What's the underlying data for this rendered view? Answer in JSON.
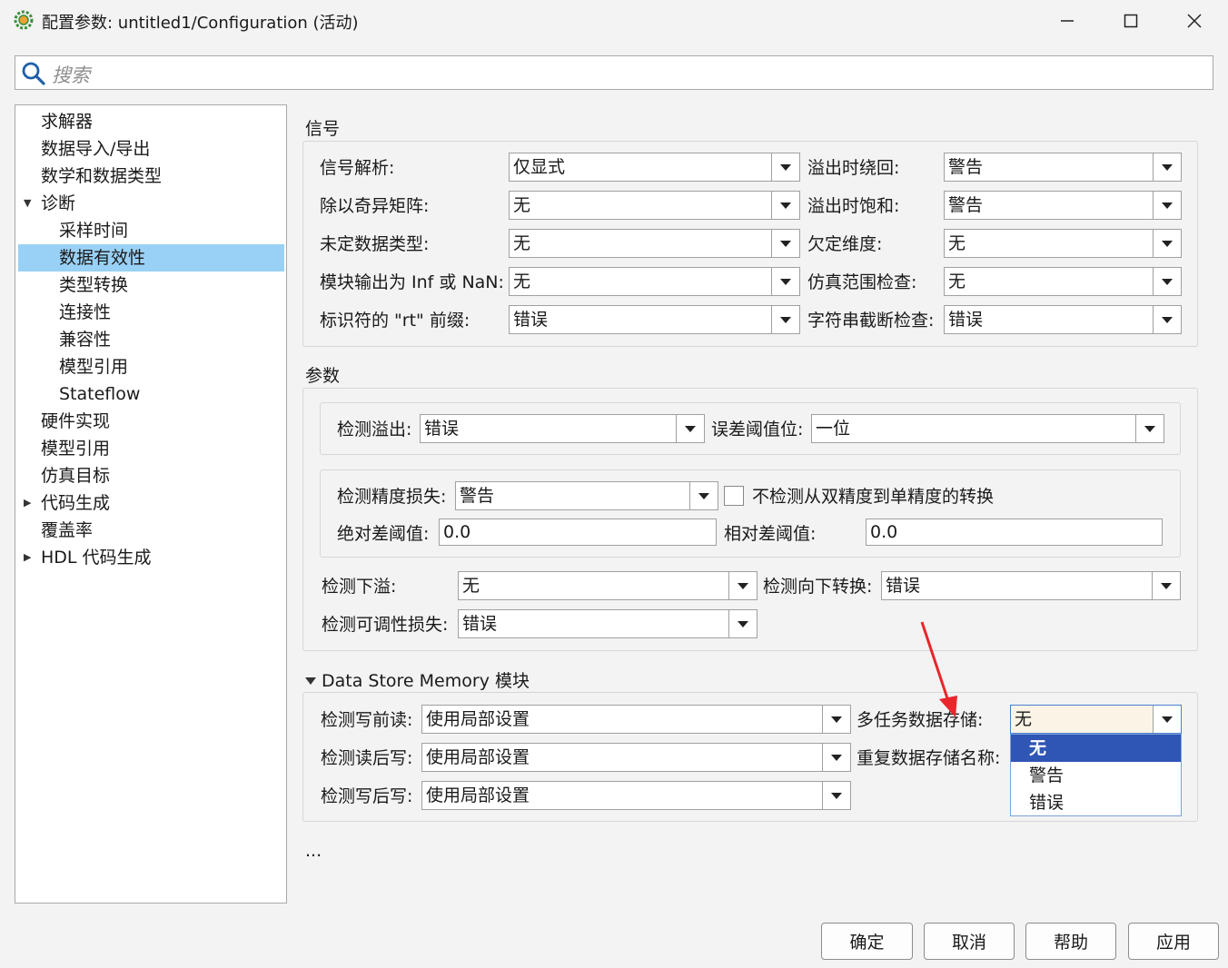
{
  "window": {
    "title": "配置参数: untitled1/Configuration (活动)",
    "app_icon": "matlab-gear-icon",
    "minimize_icon": "minimize-icon",
    "maximize_icon": "maximize-icon",
    "close_icon": "close-icon"
  },
  "search": {
    "placeholder": "搜索",
    "icon": "search-icon"
  },
  "tree": {
    "selected": "数据有效性",
    "items": [
      {
        "label": "求解器",
        "level": 0
      },
      {
        "label": "数据导入/导出",
        "level": 0
      },
      {
        "label": "数学和数据类型",
        "level": 0
      },
      {
        "label": "诊断",
        "level": 0,
        "expanded": true
      },
      {
        "label": "采样时间",
        "level": 1
      },
      {
        "label": "数据有效性",
        "level": 1
      },
      {
        "label": "类型转换",
        "level": 1
      },
      {
        "label": "连接性",
        "level": 1
      },
      {
        "label": "兼容性",
        "level": 1
      },
      {
        "label": "模型引用",
        "level": 1
      },
      {
        "label": "Stateflow",
        "level": 1
      },
      {
        "label": "硬件实现",
        "level": 0
      },
      {
        "label": "模型引用",
        "level": 0
      },
      {
        "label": "仿真目标",
        "level": 0
      },
      {
        "label": "代码生成",
        "level": 0,
        "expanded": false
      },
      {
        "label": "覆盖率",
        "level": 0
      },
      {
        "label": "HDL 代码生成",
        "level": 0,
        "expanded": false
      }
    ]
  },
  "signals": {
    "title": "信号",
    "rows": [
      {
        "label": "信号解析:",
        "value": "仅显式",
        "label2": "溢出时绕回:",
        "value2": "警告"
      },
      {
        "label": "除以奇异矩阵:",
        "value": "无",
        "label2": "溢出时饱和:",
        "value2": "警告"
      },
      {
        "label": "未定数据类型:",
        "value": "无",
        "label2": "欠定维度:",
        "value2": "无"
      },
      {
        "label": "模块输出为 Inf 或 NaN:",
        "value": "无",
        "label2": "仿真范围检查:",
        "value2": "无"
      },
      {
        "label": "标识符的 \"rt\" 前缀:",
        "value": "错误",
        "label2": "字符串截断检查:",
        "value2": "错误"
      }
    ]
  },
  "params": {
    "title": "参数",
    "overflow_label": "检测溢出:",
    "overflow_value": "错误",
    "bitlevel_label": "误差阈值位:",
    "bitlevel_value": "一位",
    "precision_label": "检测精度损失:",
    "precision_value": "警告",
    "no_double_single_label": "不检测从双精度到单精度的转换",
    "abs_tol_label": "绝对差阈值:",
    "abs_tol_value": "0.0",
    "rel_tol_label": "相对差阈值:",
    "rel_tol_value": "0.0",
    "underflow_label": "检测下溢:",
    "underflow_value": "无",
    "downcast_label": "检测向下转换:",
    "downcast_value": "错误",
    "tunable_label": "检测可调性损失:",
    "tunable_value": "错误"
  },
  "dsm": {
    "title": "Data Store Memory 模块",
    "read_before_write_label": "检测写前读:",
    "read_before_write_value": "使用局部设置",
    "write_after_read_label": "检测读后写:",
    "write_after_read_value": "使用局部设置",
    "write_after_write_label": "检测写后写:",
    "write_after_write_value": "使用局部设置",
    "multitask_label": "多任务数据存储:",
    "multitask_value": "无",
    "duplicate_label": "重复数据存储名称:",
    "dropdown_options": [
      "无",
      "警告",
      "错误"
    ],
    "dropdown_selected": "无"
  },
  "more": "...",
  "annotation": {
    "arrow_color": "#e8262b"
  },
  "buttons": {
    "ok": "确定",
    "cancel": "取消",
    "help": "帮助",
    "apply": "应用"
  }
}
